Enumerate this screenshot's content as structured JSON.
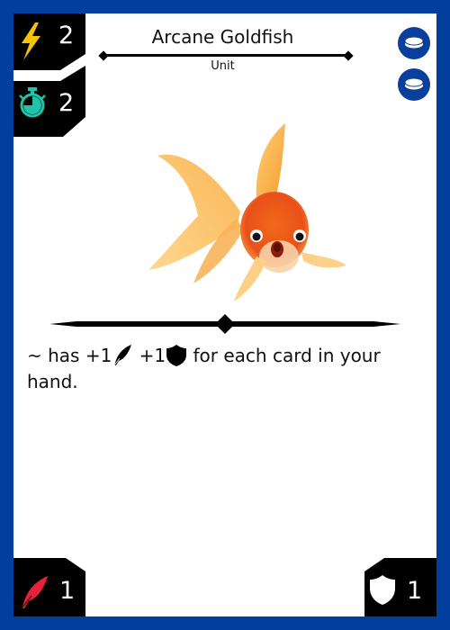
{
  "card": {
    "name": "Arcane Goldfish",
    "type_line": "Unit",
    "energy_cost": "2",
    "speed": "2",
    "attack": "1",
    "defense": "1",
    "coin_count": 2,
    "rules_text_prefix": "~ has +1",
    "rules_text_mid": " +1",
    "rules_text_suffix": " for each card in your hand.",
    "art_subject": "goldfish"
  },
  "icons": {
    "energy": "lightning-bolt-icon",
    "speed": "stopwatch-icon",
    "attack": "feather-quill-icon",
    "defense": "shield-icon",
    "coin": "coin-token-icon"
  },
  "colors": {
    "frame": "#003f9e",
    "energy": "#f5c400",
    "speed": "#1fc4a8",
    "attack": "#e8203a",
    "panel": "#000000"
  }
}
